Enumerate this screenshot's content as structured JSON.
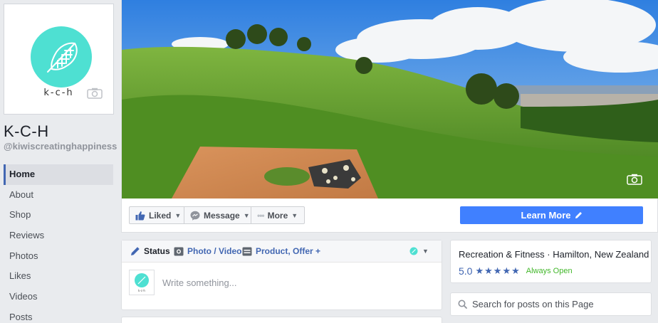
{
  "page": {
    "name": "K-C-H",
    "handle": "@kiwiscreatinghappiness",
    "logo_text": "k-c-h"
  },
  "nav": {
    "items": [
      {
        "label": "Home",
        "active": true
      },
      {
        "label": "About"
      },
      {
        "label": "Shop"
      },
      {
        "label": "Reviews"
      },
      {
        "label": "Photos"
      },
      {
        "label": "Likes"
      },
      {
        "label": "Videos"
      },
      {
        "label": "Posts"
      }
    ]
  },
  "actions": {
    "liked": "Liked",
    "message": "Message",
    "more": "More",
    "learn_more": "Learn More"
  },
  "composer": {
    "tabs": [
      "Status",
      "Photo / Video",
      "Product, Offer +"
    ],
    "placeholder": "Write something..."
  },
  "about": {
    "category": "Recreation & Fitness · Hamilton, New Zealand",
    "rating": "5.0",
    "stars": 5,
    "status": "Always Open"
  },
  "search": {
    "placeholder": "Search for posts on this Page"
  },
  "colors": {
    "brand_blue": "#4267b2",
    "button_blue": "#4080ff",
    "logo_teal": "#4ee0d2",
    "open_green": "#42b72a"
  }
}
